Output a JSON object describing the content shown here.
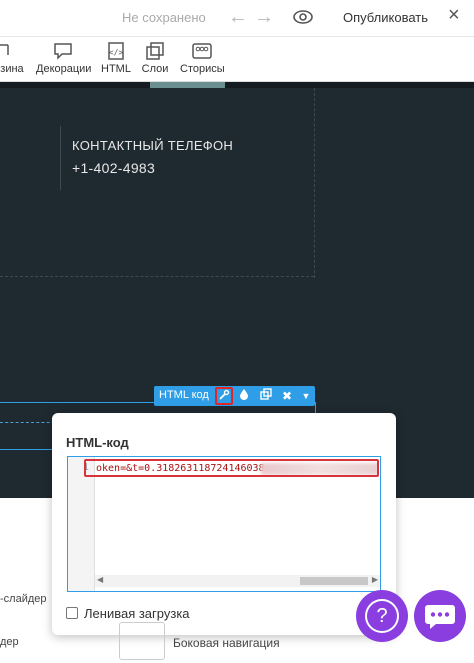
{
  "topbar": {
    "status": "Не сохранено",
    "publish": "Опубликовать"
  },
  "toolbar": {
    "items": [
      {
        "label": "зина"
      },
      {
        "label": "Декорации"
      },
      {
        "label": "HTML"
      },
      {
        "label": "Слои"
      },
      {
        "label": "Сторисы"
      }
    ]
  },
  "canvas": {
    "contact_title": "КОНТАКТНЫЙ ТЕЛЕФОН",
    "contact_phone": "+1-402-4983"
  },
  "block_bar": {
    "label": "HTML код"
  },
  "popup": {
    "title": "HTML-код",
    "line_number": "1",
    "code_visible": "oken=&t=0.318263118724146038",
    "lazy_label": "Ленивая загрузка"
  },
  "background": {
    "label_slider": "-слайдер",
    "label_der": "дер",
    "side_nav": "Боковая навигация"
  },
  "colors": {
    "accent": "#2f9ee6",
    "highlight": "#d8333b",
    "fab": "#8a3ee0",
    "canvas": "#1f2930"
  }
}
